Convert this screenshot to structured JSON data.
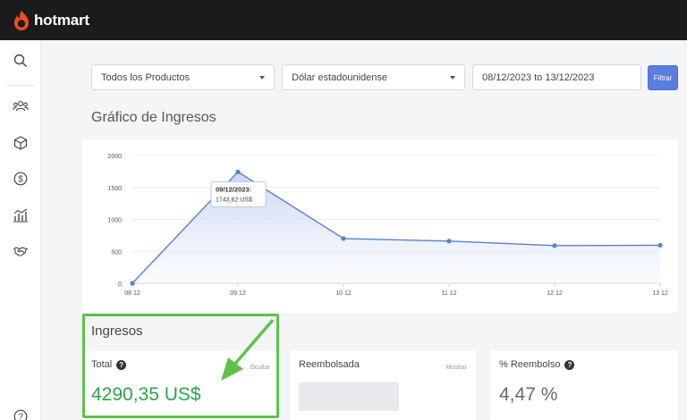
{
  "brand": {
    "name": "hotmart",
    "color": "#ef4e23"
  },
  "sidebar": {
    "icons": [
      "search-icon",
      "users-icon",
      "box-icon",
      "dollar-icon",
      "analytics-icon",
      "handshake-icon",
      "help-icon"
    ]
  },
  "filters": {
    "product": "Todos los Productos",
    "currency": "Dólar estadounidense",
    "date_range": "08/12/2023 to 13/12/2023",
    "apply_label": "Filtrar"
  },
  "chart_section": {
    "title": "Gráfico de Ingresos"
  },
  "chart_data": {
    "type": "area",
    "categories": [
      "08 12",
      "09 12",
      "10 12",
      "11 12",
      "12 12",
      "13 12"
    ],
    "values": [
      0,
      1743.62,
      700,
      660,
      590,
      595
    ],
    "ylim": [
      0,
      2000
    ],
    "yticks": [
      0,
      500,
      1000,
      1500,
      2000
    ],
    "grid": true,
    "tooltip": {
      "title": "09/12/2023:",
      "value": "1743,62 US$",
      "index": 1
    }
  },
  "ingresos": {
    "title": "Ingresos",
    "total": {
      "label": "Total",
      "link": "Ocultar",
      "value": "4290,35 US$"
    },
    "reembolsada": {
      "label": "Reembolsada",
      "link": "Mostrar"
    },
    "reembolso": {
      "label": "% Reembolso",
      "value": "4,47 %"
    }
  },
  "colors": {
    "accent": "#5a7de0",
    "line": "#5b7fd0",
    "highlight": "#5ec24a",
    "total_value": "#2da44e"
  }
}
